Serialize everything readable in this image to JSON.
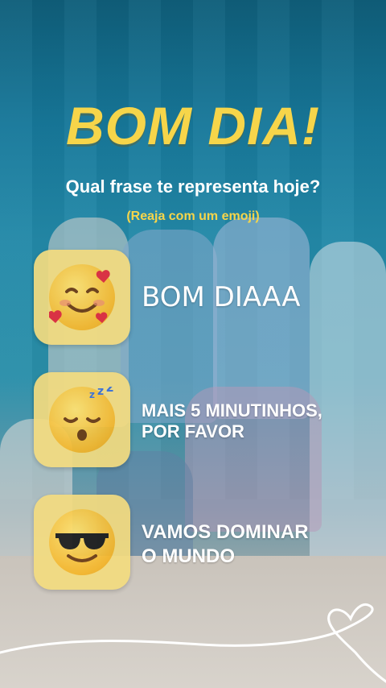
{
  "title": "BOM DIA!",
  "subtitle": "Qual frase te representa hoje?",
  "hint": "(Reaja com um emoji)",
  "options": [
    {
      "label": "BOM DIAAA",
      "icon": "smiling-face-with-hearts-icon"
    },
    {
      "label_lines": [
        "MAIS 5 MINUTINHOS,",
        "POR FAVOR"
      ],
      "icon": "sleeping-face-icon"
    },
    {
      "label_lines": [
        "VAMOS DOMINAR",
        "O MUNDO"
      ],
      "icon": "sunglasses-face-icon"
    }
  ],
  "colors": {
    "accent_yellow": "#f6d54a",
    "card": "#f4dc80",
    "text": "#ffffff"
  }
}
